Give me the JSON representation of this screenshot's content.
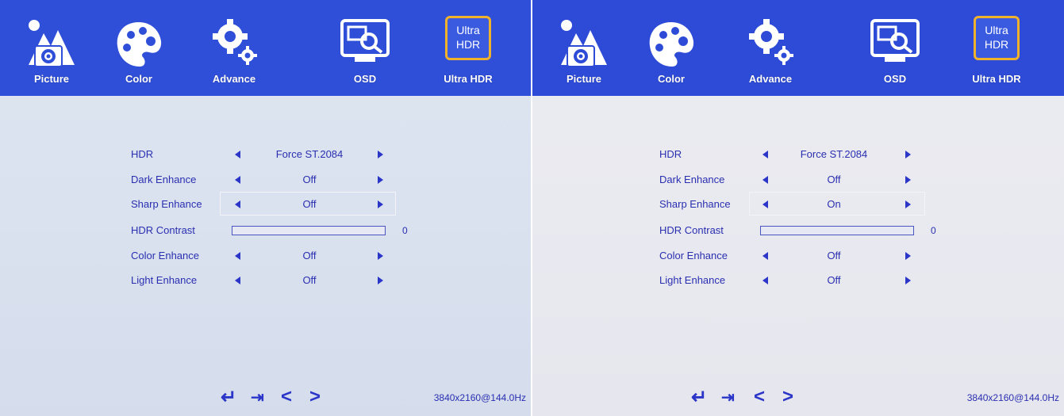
{
  "tabs": [
    {
      "label": "Picture",
      "icon": "picture-icon"
    },
    {
      "label": "Color",
      "icon": "palette-icon"
    },
    {
      "label": "Advance",
      "icon": "gear-icon"
    },
    {
      "label": "OSD",
      "icon": "osd-monitor-icon"
    },
    {
      "label": "Ultra HDR",
      "icon": "ultra-hdr-icon",
      "icon_text": "Ultra\nHDR",
      "active": true
    }
  ],
  "panels": [
    {
      "menu": [
        {
          "name": "HDR",
          "value": "Force ST.2084"
        },
        {
          "name": "Dark Enhance",
          "value": "Off"
        },
        {
          "name": "Sharp Enhance",
          "value": "Off",
          "selected": true
        },
        {
          "name": "HDR Contrast",
          "bar": true,
          "value": "0"
        },
        {
          "name": "Color Enhance",
          "value": "Off"
        },
        {
          "name": "Light Enhance",
          "value": "Off"
        }
      ],
      "resolution": "3840x2160@144.0Hz"
    },
    {
      "menu": [
        {
          "name": "HDR",
          "value": "Force ST.2084"
        },
        {
          "name": "Dark Enhance",
          "value": "Off"
        },
        {
          "name": "Sharp Enhance",
          "value": "On",
          "selected": true
        },
        {
          "name": "HDR Contrast",
          "bar": true,
          "value": "0"
        },
        {
          "name": "Color Enhance",
          "value": "Off"
        },
        {
          "name": "Light Enhance",
          "value": "Off"
        }
      ],
      "resolution": "3840x2160@144.0Hz"
    }
  ],
  "footer": {
    "icons": [
      "enter-icon",
      "exit-icon",
      "left-icon",
      "right-icon"
    ]
  },
  "colors": {
    "bar_blue": "#2f4fd8",
    "text_blue": "#2a2fb0",
    "ultra_border": "#f0b22a"
  }
}
